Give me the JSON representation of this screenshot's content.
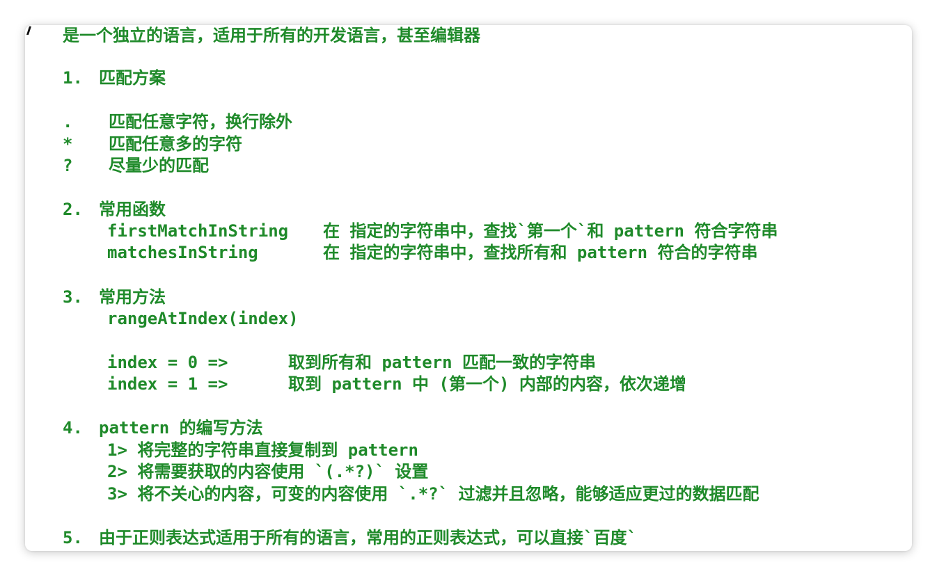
{
  "intro": "是一个独立的语言，适用于所有的开发语言，甚至编辑器",
  "section1": {
    "num": "1.",
    "title": "匹配方案",
    "items": [
      {
        "sym": ".",
        "desc": "匹配任意字符，换行除外"
      },
      {
        "sym": "*",
        "desc": "匹配任意多的字符"
      },
      {
        "sym": "?",
        "desc": "尽量少的匹配"
      }
    ]
  },
  "section2": {
    "num": "2.",
    "title": "常用函数",
    "items": [
      {
        "name": "firstMatchInString",
        "desc": "在 指定的字符串中，查找`第一个`和 pattern 符合字符串"
      },
      {
        "name": "matchesInString",
        "desc": "在 指定的字符串中，查找所有和 pattern 符合的字符串"
      }
    ]
  },
  "section3": {
    "num": "3.",
    "title": "常用方法",
    "method": "rangeAtIndex(index)",
    "items": [
      {
        "code": "index = 0 =>",
        "desc": "取到所有和 pattern 匹配一致的字符串"
      },
      {
        "code": "index = 1 =>",
        "desc": "取到 pattern 中 (第一个) 内部的内容，依次递增"
      }
    ]
  },
  "section4": {
    "num": "4.",
    "title": "pattern 的编写方法",
    "steps": [
      "1> 将完整的字符串直接复制到 pattern",
      "2> 将需要获取的内容使用 `(.*?)` 设置",
      "3> 将不关心的内容，可变的内容使用 `.*?` 过滤并且忽略，能够适应更过的数据匹配"
    ]
  },
  "section5": {
    "num": "5.",
    "title": "由于正则表达式适用于所有的语言，常用的正则表达式，可以直接`百度`"
  },
  "colors": {
    "text": "#1f8a2a",
    "background": "#ffffff"
  }
}
